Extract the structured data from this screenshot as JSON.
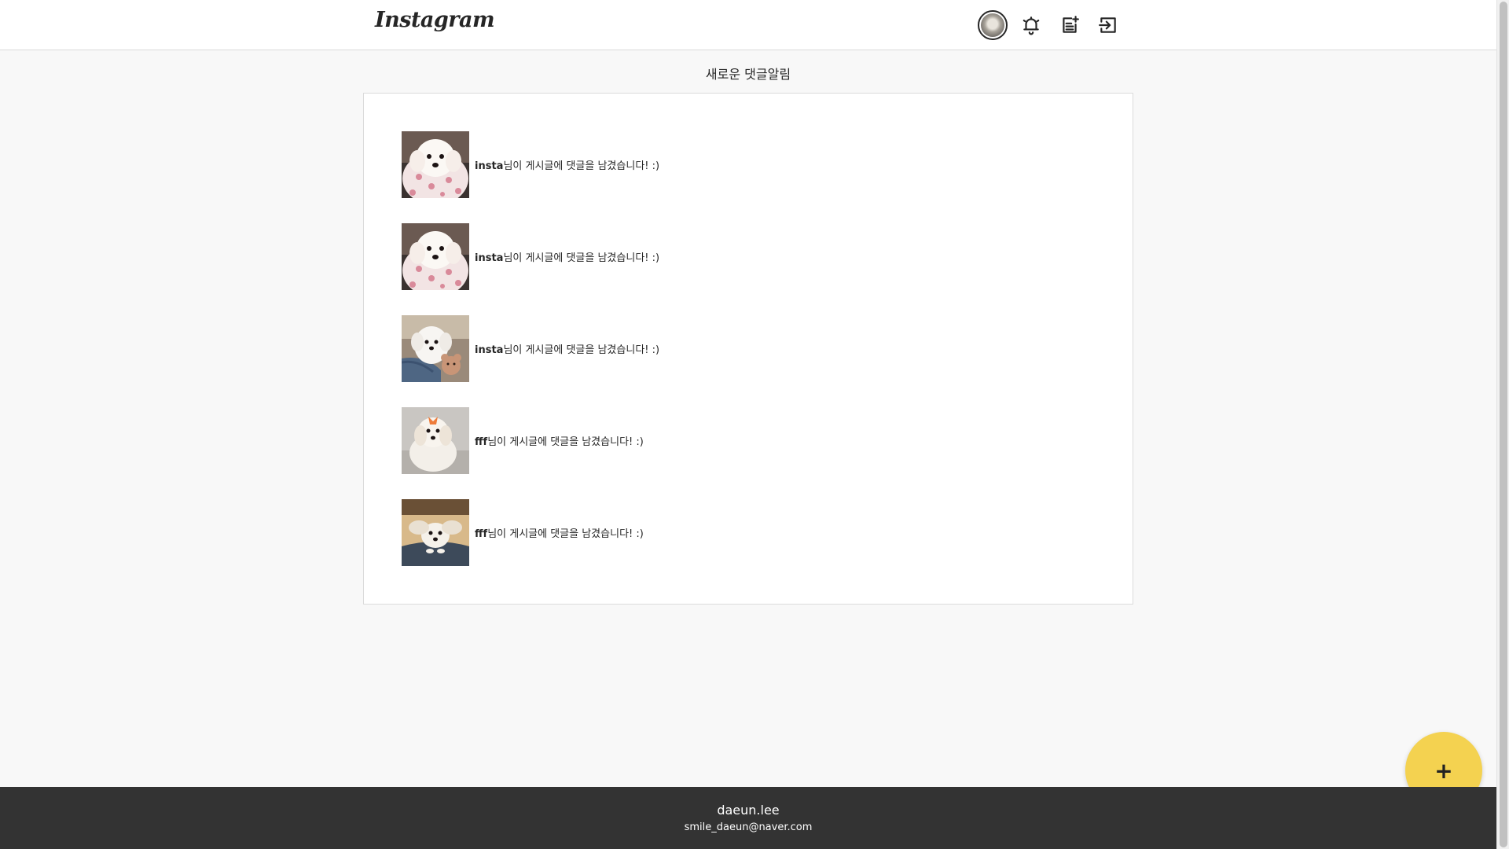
{
  "header": {
    "logo": "Instagram",
    "icons": [
      "avatar",
      "bell-icon",
      "new-post-icon",
      "logout-icon"
    ]
  },
  "main": {
    "title": "새로운 댓글알림",
    "notifications": [
      {
        "user": "insta",
        "message": "님이 게시글에 댓글을 남겼습니다! :)",
        "thumb": "dog-pink-blanket"
      },
      {
        "user": "insta",
        "message": "님이 게시글에 댓글을 남겼습니다! :)",
        "thumb": "dog-pink-blanket"
      },
      {
        "user": "insta",
        "message": "님이 게시글에 댓글을 남겼습니다! :)",
        "thumb": "dog-with-toy"
      },
      {
        "user": "fff",
        "message": "님이 게시글에 댓글을 남겼습니다! :)",
        "thumb": "dog-orange-bow"
      },
      {
        "user": "fff",
        "message": "님이 게시글에 댓글을 남겼습니다! :)",
        "thumb": "dog-on-cushion"
      }
    ]
  },
  "fab": {
    "label": "+"
  },
  "footer": {
    "name": "daeun.lee",
    "email": "smile_daeun@naver.com"
  },
  "colors": {
    "background": "#f8f8f8",
    "card": "#ffffff",
    "border": "#dbdbdb",
    "fab": "#f4d250",
    "footer": "#333333"
  }
}
